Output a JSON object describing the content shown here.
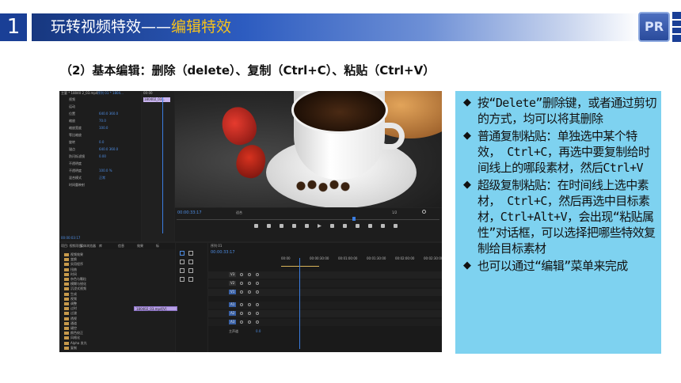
{
  "header": {
    "number": "1",
    "title_prefix": "玩转视频特效——",
    "title_highlight": "编辑特效",
    "logo_text": "PR",
    "accent_color": "#f6c21c",
    "bar_color": "#1a3f96"
  },
  "subtitle": "（2）基本编辑：删除（delete）、复制（Ctrl+C）、粘贴（Ctrl+V）",
  "screenshot": {
    "effect_controls": {
      "tab_label": "主要 * 18040 2_03.mp4",
      "tab_active": "序列 01 * 1804...",
      "clip_label": "180402_03...",
      "time_top": "00:00",
      "rows": [
        {
          "label": "视频",
          "value": ""
        },
        {
          "label": "运动",
          "value": ""
        },
        {
          "label": "位置",
          "value": "640.0   360.0"
        },
        {
          "label": "缩放",
          "value": "70.0"
        },
        {
          "label": "缩放宽度",
          "value": "100.0"
        },
        {
          "label": "等比缩放",
          "value": ""
        },
        {
          "label": "旋转",
          "value": "0.0"
        },
        {
          "label": "锚点",
          "value": "640.0   360.0"
        },
        {
          "label": "防闪烁滤镜",
          "value": "0.00"
        },
        {
          "label": "不透明度",
          "value": ""
        },
        {
          "label": "不透明度",
          "value": "100.0 %"
        },
        {
          "label": "混合模式",
          "value": "正常"
        },
        {
          "label": "时间重映射",
          "value": ""
        }
      ],
      "time_bottom": "00:00:03:17"
    },
    "program": {
      "timecode": "00:00:33:17",
      "fit_label": "适合",
      "fraction": "1/2"
    },
    "project": {
      "tabs": [
        "项目: 视频项目",
        "媒体浏览器",
        "库",
        "信息",
        "效果",
        "标"
      ],
      "items": [
        "视频效果",
        "变换",
        "实用程序",
        "扭曲",
        "时间",
        "杂色与颗粒",
        "模糊与锐化",
        "沉浸式视频",
        "生成",
        "视频",
        "调整",
        "过时",
        "过渡",
        "透视",
        "通道",
        "键控",
        "颜色校正",
        "风格化",
        "Alpha 发光",
        "复制"
      ]
    },
    "timeline": {
      "tab": "序列 01",
      "timecode": "00:00:33:17",
      "ruler": [
        "00:00",
        "00:00:30:00",
        "00:01:00:00",
        "00:01:30:00",
        "00:02:00:00",
        "00:02:30:00"
      ],
      "video_tracks": [
        "V3",
        "V2",
        "V1"
      ],
      "audio_tracks": [
        "A1",
        "A2",
        "A3"
      ],
      "master_label": "主声道",
      "master_value": "0.0",
      "clip_label": "180402_03.mp4[V]"
    }
  },
  "bullets": [
    "按“Delete”删除键，或者通过剪切的方式，均可以将其删除",
    "普通复制粘贴：单独选中某个特效， Ctrl+C，再选中要复制给时间线上的哪段素材，然后Ctrl+V",
    "超级复制粘贴：在时间线上选中素材， Ctrl+C，然后再选中目标素材，Ctrl+Alt+V，会出现“粘贴属性”对话框，可以选择把哪些特效复制给目标素材",
    "也可以通过“编辑”菜单来完成"
  ],
  "bullet_box_color": "#7ed2f0"
}
